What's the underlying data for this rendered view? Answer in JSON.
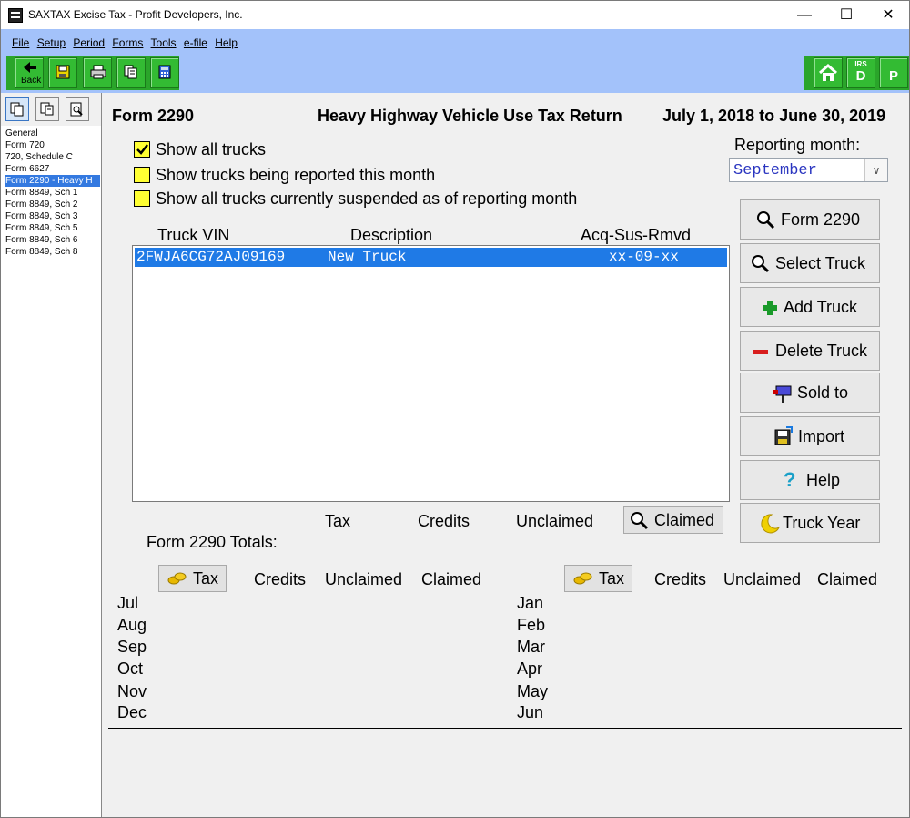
{
  "window": {
    "title": "SAXTAX Excise Tax - Profit Developers, Inc.",
    "controls": {
      "minimize": "—",
      "maximize": "☐",
      "close": "✕"
    }
  },
  "menu": [
    "File",
    "Setup",
    "Period",
    "Forms",
    "Tools",
    "e-file",
    "Help"
  ],
  "toolbar": {
    "back_label": "Back",
    "right": {
      "irs_top": "IRS",
      "irs_letter": "D",
      "p_letter": "P"
    }
  },
  "left_panel": {
    "items": [
      "General",
      "Form 720",
      "720, Schedule C",
      "Form 6627",
      "Form 2290 - Heavy H",
      "Form 8849, Sch 1",
      "Form 8849, Sch 2",
      "Form 8849, Sch 3",
      "Form 8849, Sch 5",
      "Form 8849, Sch 6",
      "Form 8849, Sch 8"
    ],
    "selected_index": 4
  },
  "header": {
    "form": "Form 2290",
    "title": "Heavy Highway Vehicle Use Tax Return",
    "period": "July 1, 2018 to June 30, 2019"
  },
  "options": {
    "show_all": "Show all trucks",
    "show_reported": "Show trucks being reported this month",
    "show_suspended": "Show all trucks currently suspended as of reporting month"
  },
  "reporting_month": {
    "label": "Reporting month:",
    "value": "September"
  },
  "truck_table": {
    "columns": [
      "Truck VIN",
      "Description",
      "Acq-Sus-Rmvd"
    ],
    "rows": [
      {
        "vin": "2FWJA6CG72AJ09169",
        "description": "New Truck",
        "acq": "xx-09-xx"
      }
    ]
  },
  "side_buttons": {
    "form2290": "Form 2290",
    "select_truck": "Select Truck",
    "add_truck": "Add Truck",
    "delete_truck": "Delete Truck",
    "sold_to": "Sold to",
    "import": "Import",
    "help": "Help",
    "truck_year": "Truck Year"
  },
  "summary": {
    "tax": "Tax",
    "credits": "Credits",
    "unclaimed": "Unclaimed",
    "claimed_button": "Claimed",
    "totals_label": "Form 2290 Totals:"
  },
  "monthly": {
    "tax_button": "Tax",
    "credits": "Credits",
    "unclaimed": "Unclaimed",
    "claimed": "Claimed",
    "left_months": [
      "Jul",
      "Aug",
      "Sep",
      "Oct",
      "Nov",
      "Dec"
    ],
    "right_months": [
      "Jan",
      "Feb",
      "Mar",
      "Apr",
      "May",
      "Jun"
    ]
  }
}
